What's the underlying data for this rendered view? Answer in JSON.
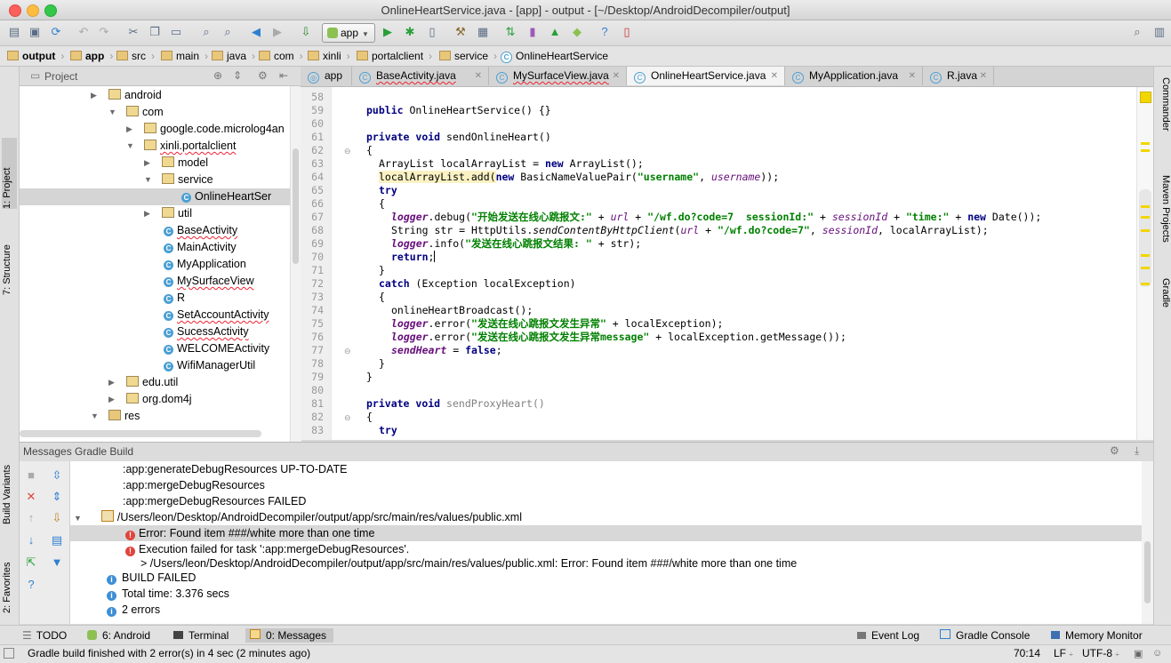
{
  "window": {
    "title": "OnlineHeartService.java - [app] - output - [~/Desktop/AndroidDecompiler/output]"
  },
  "toolbar": {
    "run_config": "app"
  },
  "breadcrumb": [
    "output",
    "app",
    "src",
    "main",
    "java",
    "com",
    "xinli",
    "portalclient",
    "service",
    "OnlineHeartService"
  ],
  "left_strip": {
    "project": "1: Project",
    "structure": "7: Structure",
    "build_variants": "Build Variants",
    "favorites": "2: Favorites"
  },
  "right_strip": {
    "commander": "Commander",
    "maven": "Maven Projects",
    "gradle": "Gradle"
  },
  "project_panel": {
    "header": "Project",
    "tree": [
      {
        "label": "android"
      },
      {
        "label": "com"
      },
      {
        "label": "google.code.microlog4an"
      },
      {
        "label": "xinli.portalclient"
      },
      {
        "label": "model"
      },
      {
        "label": "service"
      },
      {
        "label": "OnlineHeartSer"
      },
      {
        "label": "util"
      },
      {
        "label": "BaseActivity"
      },
      {
        "label": "MainActivity"
      },
      {
        "label": "MyApplication"
      },
      {
        "label": "MySurfaceView"
      },
      {
        "label": "R"
      },
      {
        "label": "SetAccountActivity"
      },
      {
        "label": "SucessActivity"
      },
      {
        "label": "WELCOMEActivity"
      },
      {
        "label": "WifiManagerUtil"
      },
      {
        "label": "edu.util"
      },
      {
        "label": "org.dom4j"
      },
      {
        "label": "res"
      }
    ]
  },
  "editor": {
    "tabs": [
      "app",
      "BaseActivity.java",
      "MySurfaceView.java",
      "OnlineHeartService.java",
      "MyApplication.java",
      "R.java"
    ],
    "active_tab": "OnlineHeartService.java",
    "line_numbers": [
      "58",
      "59",
      "60",
      "61",
      "62",
      "63",
      "64",
      "65",
      "66",
      "67",
      "68",
      "69",
      "70",
      "71",
      "72",
      "73",
      "74",
      "75",
      "76",
      "77",
      "78",
      "79",
      "80",
      "81",
      "82",
      "83"
    ],
    "t": {
      "public": "public",
      "private": "private",
      "void": "void",
      "new": "new",
      "try": "try",
      "return": "return",
      "catch": "catch",
      "false": "false",
      "ctor": "OnlineHeartService() {}",
      "send_online": "sendOnlineHeart()",
      "send_proxy": "sendProxyHeart()",
      "open_brace": "{",
      "close_brace": "}",
      "l63": "ArrayList localArrayList = ",
      "l63b": "ArrayList();",
      "l64a": "localArrayList.add(",
      "l64b": "BasicNameValuePair(",
      "s_username": "\"username\"",
      "comma": ", ",
      "f_username": "username",
      "l64c": "));",
      "f_logger": "logger",
      ".debug(": ".debug(",
      "s67a": "\"开始发送在线心跳报文:\"",
      "plus": " + ",
      "f_url": "url",
      "s67b": "\"/wf.do?code=7  sessionId:\"",
      "f_sessionId": "sessionId",
      "s67c": "\"time:\"",
      "l67end": "Date());",
      "l68a": "String str = HttpUtils.",
      "l68b": "sendContentByHttpClient",
      "paren_open": "(",
      "s68": "\"/wf.do?code=7\"",
      "l68end": ", localArrayList);",
      ".info(": ".info(",
      "s69": "\"发送在线心跳报文结果: \"",
      "str_end": " + str);",
      "semicolon": ";",
      "l72": " (Exception localException)",
      "l75": "onlineHeartBroadcast();",
      ".error(": ".error(",
      "s76": "\"发送在线心跳报文发生异常\"",
      "l76end": " + localException);",
      "s77": "\"发送在线心跳报文发生异常message\"",
      "l77end": " + localException.getMessage());",
      "f_sendHeart": "sendHeart",
      "assign": " = "
    }
  },
  "messages": {
    "header": "Messages Gradle Build",
    "lines": [
      ":app:generateDebugResources UP-TO-DATE",
      ":app:mergeDebugResources",
      ":app:mergeDebugResources FAILED",
      "/Users/leon/Desktop/AndroidDecompiler/output/app/src/main/res/values/public.xml",
      "Error: Found item ###/white more than one time",
      "Execution failed for task ':app:mergeDebugResources'.",
      "> /Users/leon/Desktop/AndroidDecompiler/output/app/src/main/res/values/public.xml: Error: Found item ###/white more than one time",
      "BUILD FAILED",
      "Total time: 3.376 secs",
      "2 errors"
    ]
  },
  "bottom_tabs": {
    "todo": "TODO",
    "android": "6: Android",
    "terminal": "Terminal",
    "messages": "0: Messages",
    "event_log": "Event Log",
    "gradle_console": "Gradle Console",
    "memory_monitor": "Memory Monitor"
  },
  "status_bar": {
    "message": "Gradle build finished with 2 error(s) in 4 sec (2 minutes ago)",
    "position": "70:14",
    "line_sep": "LF",
    "encoding": "UTF-8"
  },
  "colors": {
    "keyword": "#000080",
    "string": "#008000",
    "field": "#660e7a",
    "error": "#e0443d",
    "info": "#3e8fd5"
  }
}
